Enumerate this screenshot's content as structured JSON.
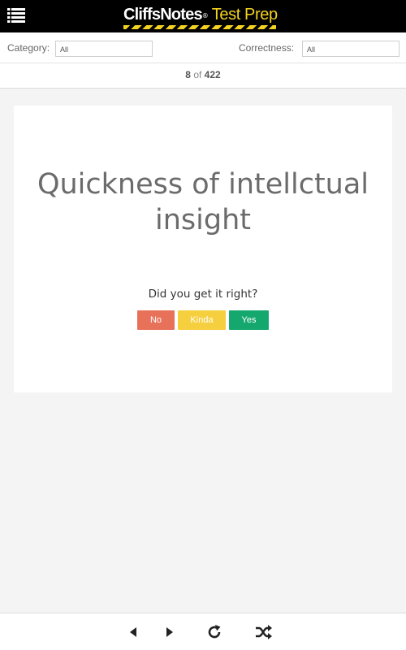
{
  "header": {
    "brand": "CliffsNotes",
    "registered_mark": "®",
    "product": "Test Prep",
    "icons": [
      "menu-icon"
    ]
  },
  "filters": {
    "category_label": "Category:",
    "category_value": "All",
    "correctness_label": "Correctness:",
    "correctness_value": "All"
  },
  "counter": {
    "current": "8",
    "separator": "of",
    "total": "422"
  },
  "card": {
    "term": "Quickness of intellctual insight",
    "question": "Did you get it right?",
    "buttons": {
      "no": "No",
      "kinda": "Kinda",
      "yes": "Yes"
    }
  },
  "colors": {
    "no": "#e8715a",
    "kinda": "#f6cf3f",
    "yes": "#15a86e",
    "brand_accent": "#f4d321"
  },
  "footer": {
    "icons": [
      "previous-icon",
      "next-icon",
      "refresh-icon",
      "shuffle-icon"
    ]
  }
}
